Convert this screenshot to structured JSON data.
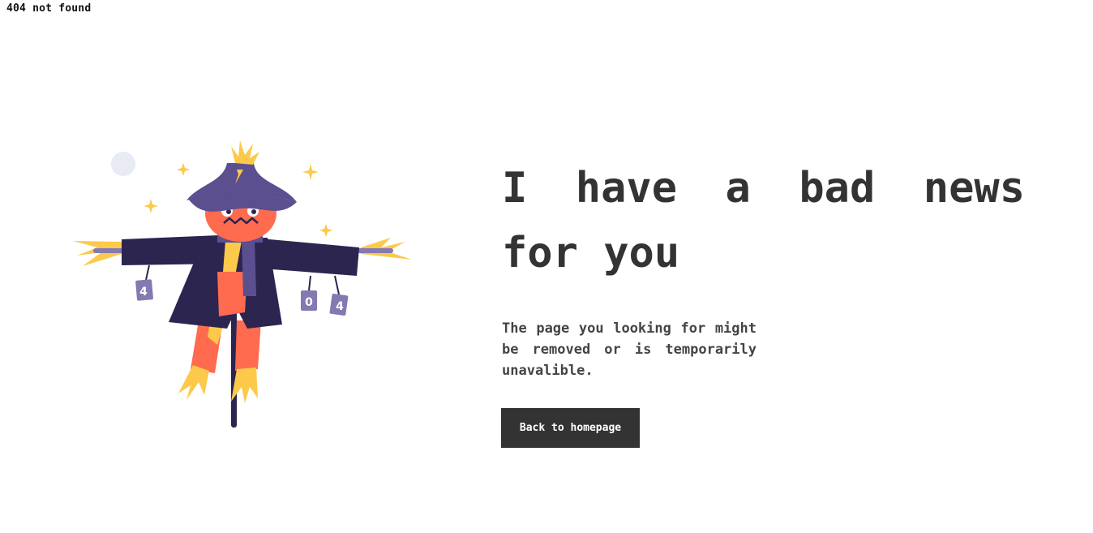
{
  "page": {
    "top_label": "404 not found"
  },
  "hero": {
    "headline_line1": "I have a bad news",
    "headline_line2": "for you",
    "description": "The page you looking for might be removed or is temporarily unavalible.",
    "button_label": "Back to homepage"
  },
  "illustration": {
    "subject": "scarecrow-illustration",
    "can_labels": [
      "4",
      "0",
      "4"
    ]
  },
  "colors": {
    "text": "#333333",
    "button_bg": "#333333",
    "button_text": "#ffffff",
    "hat": "#5b4f8f",
    "coat": "#2c2550",
    "face": "#ff6b4f",
    "straw": "#fcc94a",
    "moon": "#e8ebf4"
  }
}
